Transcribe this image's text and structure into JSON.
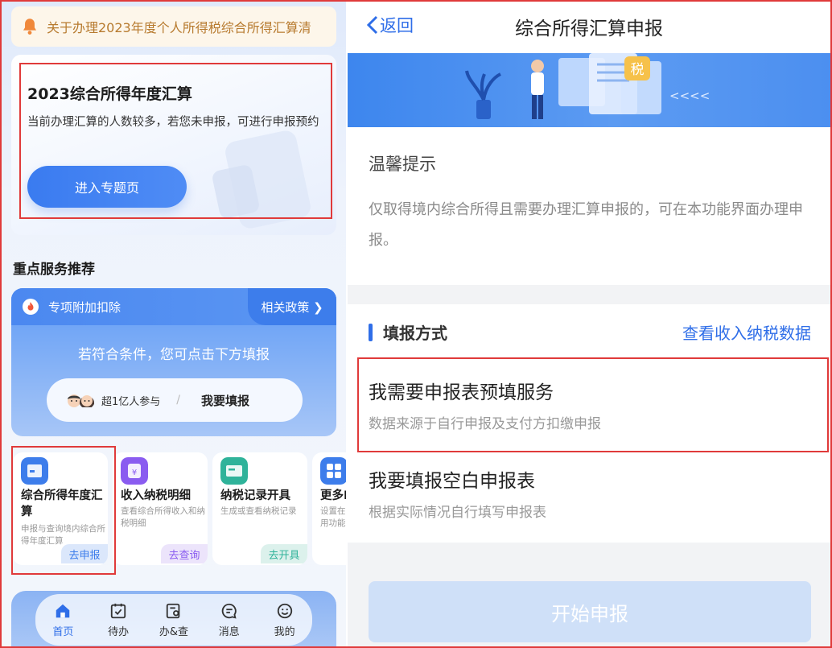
{
  "left": {
    "notice": {
      "text": "关于办理2023年度个人所得税综合所得汇算清"
    },
    "feature": {
      "title": "2023综合所得年度汇算",
      "desc": "当前办理汇算的人数较多，若您未申报，可进行申报预约",
      "button": "进入专题页"
    },
    "section_title": "重点服务推荐",
    "deduction": {
      "header": "专项附加扣除",
      "policy": "相关政策 ❯",
      "hint": "若符合条件，您可点击下方填报",
      "participants": "超1亿人参与",
      "separator": "/",
      "action": "我要填报"
    },
    "services": [
      {
        "name": "综合所得年度汇算",
        "desc": "申报与查询境内综合所得年度汇算",
        "action": "去申报",
        "color": "#3d7deb"
      },
      {
        "name": "收入纳税明细",
        "desc": "查看综合所得收入和纳税明细",
        "action": "去查询",
        "color": "#8a5cf0"
      },
      {
        "name": "纳税记录开具",
        "desc": "生成或查看纳税记录",
        "action": "去开具",
        "color": "#2fb39a"
      },
      {
        "name": "更多I",
        "desc": "设置在用功能",
        "action": "",
        "color": "#3d7deb"
      }
    ],
    "tabs": [
      {
        "label": "首页",
        "icon": "home-icon",
        "active": true
      },
      {
        "label": "待办",
        "icon": "todo-icon",
        "active": false
      },
      {
        "label": "办&查",
        "icon": "query-icon",
        "active": false
      },
      {
        "label": "消息",
        "icon": "message-icon",
        "active": false
      },
      {
        "label": "我的",
        "icon": "profile-icon",
        "active": false
      }
    ]
  },
  "right": {
    "nav": {
      "back": "返回",
      "title": "综合所得汇算申报"
    },
    "banner": {
      "badge": "税",
      "arrows": "<<<<"
    },
    "tip": {
      "title": "温馨提示",
      "body": "仅取得境内综合所得且需要办理汇算申报的，可在本功能界面办理申报。"
    },
    "method": {
      "title": "填报方式",
      "view_link": "查看收入纳税数据",
      "options": [
        {
          "title": "我需要申报表预填服务",
          "desc": "数据来源于自行申报及支付方扣缴申报"
        },
        {
          "title": "我要填报空白申报表",
          "desc": "根据实际情况自行填写申报表"
        }
      ]
    },
    "start_button": "开始申报"
  },
  "colors": {
    "accent": "#2f6ee8",
    "highlight": "#e03a3a"
  }
}
